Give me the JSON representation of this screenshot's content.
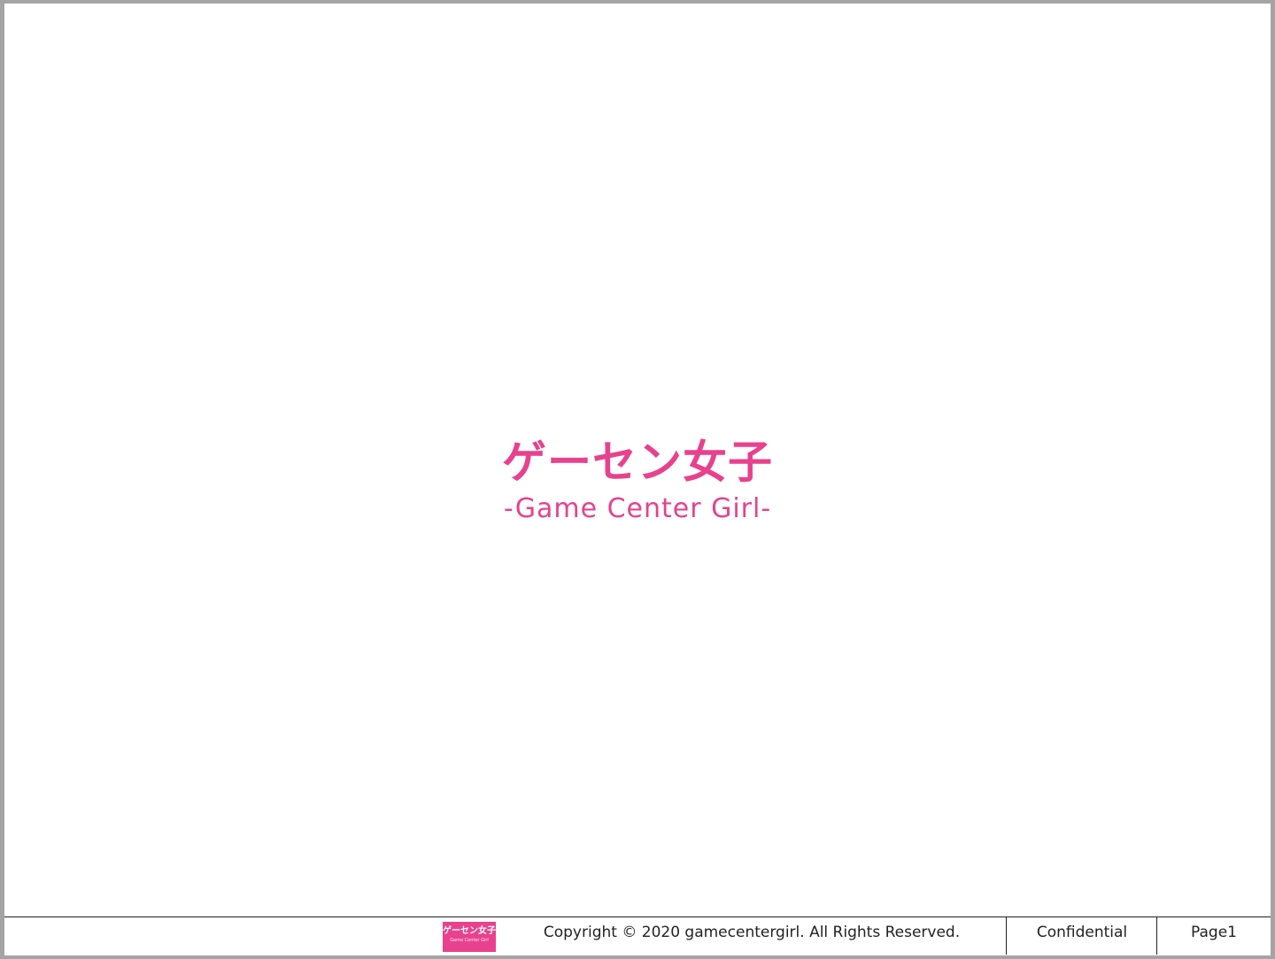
{
  "colors": {
    "brand": "#e8418d"
  },
  "title": {
    "japanese": "ゲーセン女子",
    "english": "-Game Center Girl-"
  },
  "footer": {
    "logo": {
      "japanese": "ゲーセン女子",
      "english": "Game Center Girl"
    },
    "copyright": "Copyright © 2020 gamecentergirl. All Rights Reserved.",
    "classification": "Confidential",
    "page_label": "Page1"
  }
}
